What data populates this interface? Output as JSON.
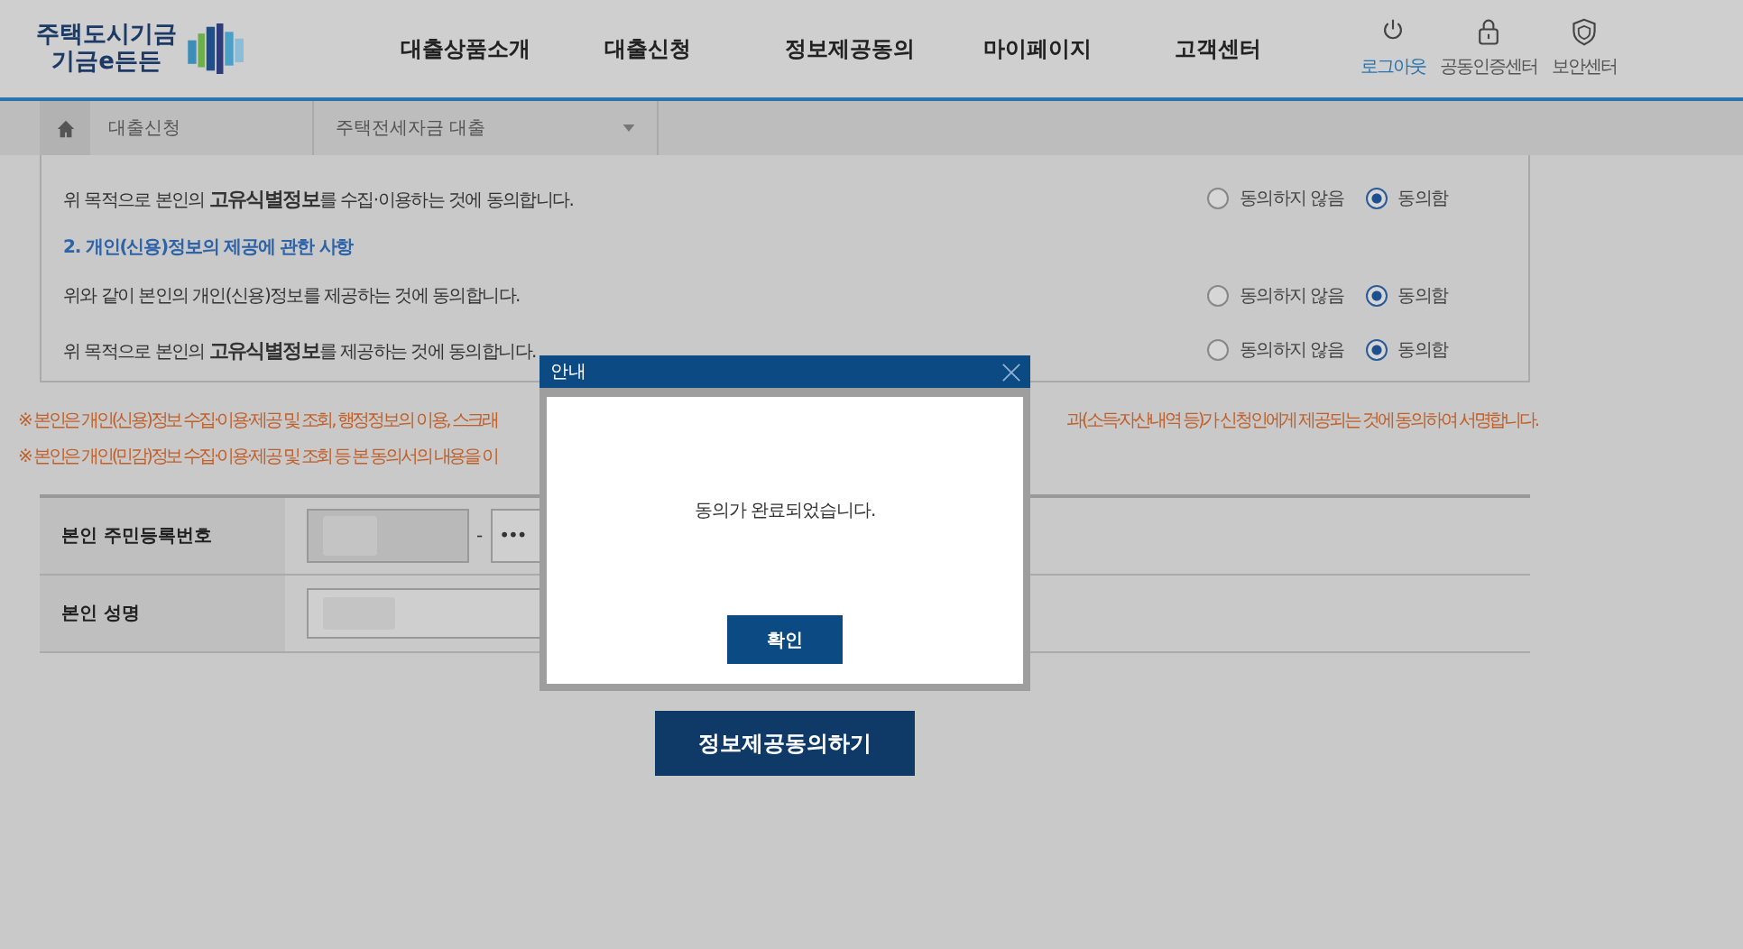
{
  "header": {
    "logo": {
      "line_1": "주택도시기금",
      "line_2": "기금e든든"
    },
    "nav": [
      {
        "label": "대출상품소개"
      },
      {
        "label": "대출신청"
      },
      {
        "label": "정보제공동의"
      },
      {
        "label": "마이페이지"
      },
      {
        "label": "고객센터"
      }
    ],
    "utilities": [
      {
        "label": "로그아웃",
        "kind": "power",
        "active": true
      },
      {
        "label": "공동인증센터",
        "kind": "lock",
        "active": false
      },
      {
        "label": "보안센터",
        "kind": "shield",
        "active": false
      }
    ]
  },
  "breadcrumb": {
    "section": "대출신청",
    "select": "주택전세자금 대출"
  },
  "consent_rows": [
    {
      "kind": "statement",
      "text": "위 목적으로 본인의 **고유식별정보**를 수집·이용하는 것에 동의합니다.",
      "options": [
        {
          "label": "동의하지 않음",
          "selected": false
        },
        {
          "label": "동의함",
          "selected": true
        }
      ]
    },
    {
      "kind": "heading",
      "text": "2. 개인(신용)정보의 제공에 관한 사항"
    },
    {
      "kind": "statement",
      "text": "위와 같이 본인의 개인(신용)정보를 제공하는 것에 동의합니다.",
      "options": [
        {
          "label": "동의하지 않음",
          "selected": false
        },
        {
          "label": "동의함",
          "selected": true
        }
      ]
    },
    {
      "kind": "statement",
      "text": "위 목적으로 본인의 **고유식별정보**를 제공하는 것에 동의합니다.",
      "options": [
        {
          "label": "동의하지 않음",
          "selected": false
        },
        {
          "label": "동의함",
          "selected": true
        }
      ]
    }
  ],
  "notes": [
    {
      "left": "※ 본인은 개인(신용)정보 수집·이용·제공 및 조회, 행정정보의 이용, 스크래",
      "right": "과(소득·자산내역 등)가 신청인에게 제공되는 것에 동의하여 서명합니다."
    },
    {
      "left": "※ 본인은 개인(민감)정보 수집·이용·제공 및 조회 등 본 동의서의 내용을 이"
    }
  ],
  "identity_form": [
    {
      "label": "본인 주민등록번호",
      "kind": "resident_number",
      "separator": "-",
      "masked": "•••"
    },
    {
      "label": "본인 성명",
      "kind": "name"
    }
  ],
  "submit_button": "정보제공동의하기",
  "dialog": {
    "title": "안내",
    "message": "동의가 완료되었습니다.",
    "button": "확인"
  }
}
